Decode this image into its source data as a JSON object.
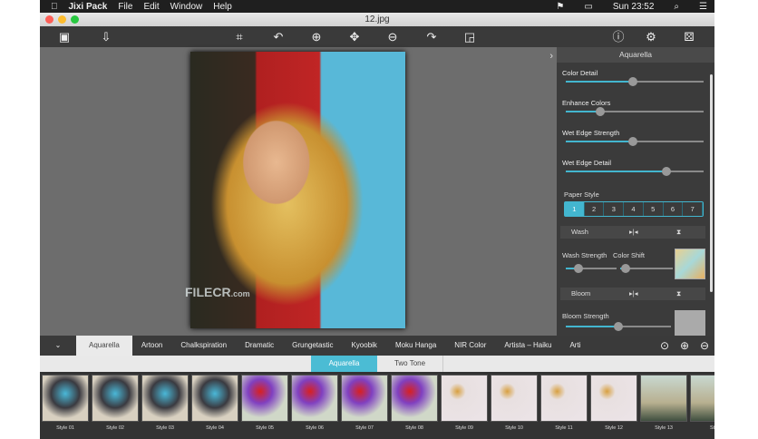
{
  "menubar": {
    "app": "Jixi Pack",
    "items": [
      "File",
      "Edit",
      "Window",
      "Help"
    ],
    "clock": "Sun 23:52"
  },
  "window": {
    "title": "12.jpg"
  },
  "toolbar": {
    "left": [
      "compare-icon",
      "save-icon"
    ],
    "center": [
      "crop-icon",
      "rotate-left-icon",
      "zoom-in-icon",
      "move-icon",
      "zoom-out-icon",
      "rotate-right-icon",
      "fit-icon"
    ],
    "right": [
      "info-icon",
      "settings-icon",
      "randomize-icon"
    ]
  },
  "watermark": {
    "text": "FILECR",
    "suffix": ".com"
  },
  "panel": {
    "title": "Aquarella",
    "sliders": [
      {
        "label": "Color Detail",
        "value": 0.49
      },
      {
        "label": "Enhance Colors",
        "value": 0.25
      },
      {
        "label": "Wet Edge Strength",
        "value": 0.49
      },
      {
        "label": "Wet Edge Detail",
        "value": 0.73
      }
    ],
    "paper_style": {
      "label": "Paper Style",
      "options": [
        "1",
        "2",
        "3",
        "4",
        "5",
        "6",
        "7"
      ],
      "selected": "1"
    },
    "wash": {
      "label": "Wash",
      "strength_label": "Wash Strength",
      "strength": 0.25,
      "shift_label": "Color Shift",
      "shift": 0.1
    },
    "bloom": {
      "label": "Bloom",
      "strength_label": "Bloom Strength",
      "strength": 0.5
    }
  },
  "tabs": [
    "Aquarella",
    "Artoon",
    "Chalkspiration",
    "Dramatic",
    "Grungetastic",
    "Kyoobik",
    "Moku Hanga",
    "NIR Color",
    "Artista – Haiku",
    "Arti"
  ],
  "active_tab": "Aquarella",
  "subtabs": [
    "Aquarella",
    "Two Tone"
  ],
  "styles": [
    {
      "label": "Style 01",
      "k": "f"
    },
    {
      "label": "Style 02",
      "k": "f"
    },
    {
      "label": "Style 03",
      "k": "f"
    },
    {
      "label": "Style 04",
      "k": "f"
    },
    {
      "label": "Style 05",
      "k": "fl"
    },
    {
      "label": "Style 06",
      "k": "fl"
    },
    {
      "label": "Style 07",
      "k": "fl"
    },
    {
      "label": "Style 08",
      "k": "fl"
    },
    {
      "label": "Style 09",
      "k": "o"
    },
    {
      "label": "Style 10",
      "k": "o"
    },
    {
      "label": "Style 11",
      "k": "o"
    },
    {
      "label": "Style 12",
      "k": "o"
    },
    {
      "label": "Style 13",
      "k": "s"
    },
    {
      "label": "Sty",
      "k": "s"
    }
  ]
}
